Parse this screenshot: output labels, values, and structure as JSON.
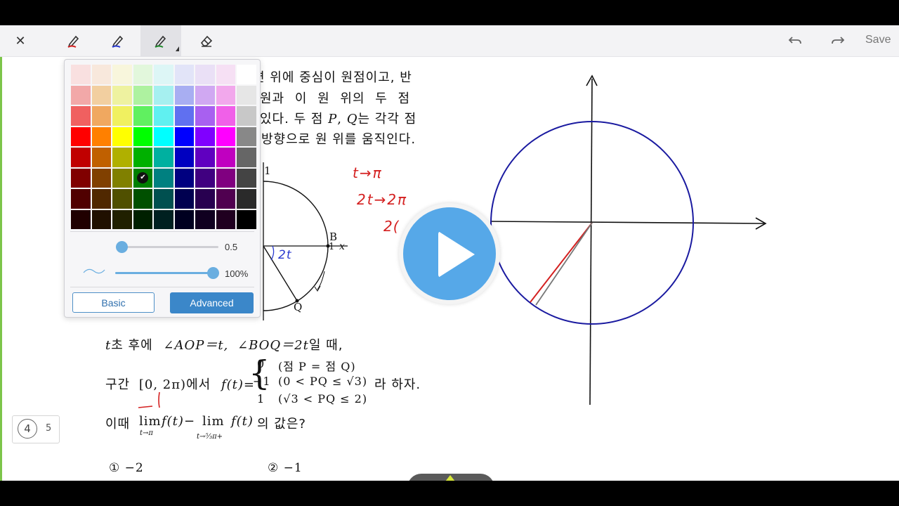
{
  "toolbar": {
    "save_label": "Save",
    "tools": [
      "close",
      "pen-red",
      "pen-blue",
      "pen-green",
      "eraser",
      "undo",
      "redo"
    ],
    "pen_colors": {
      "red": "#d42020",
      "blue": "#2a3ad0",
      "green": "#1f8a2c"
    }
  },
  "problem": {
    "line1": "면 위에 중심이 원점이고, 반",
    "line2": "원과 이 원 위의 두 점",
    "line3": "있다. 두 점",
    "line3_p": "P",
    "line3_sep": ",",
    "line3_q": "Q",
    "line3_rest": "는 각각 점",
    "line4": "방향으로 원 위를 움직인다.",
    "cond_t": "t",
    "cond_text1": "초 후에",
    "cond_angle1": "∠AOP＝t,",
    "cond_angle2": "∠BOQ＝2t",
    "cond_text2": "일 때,",
    "interval_label": "구간",
    "interval": "[0, 2π)",
    "interval_suffix": "에서",
    "f_def": "f(t)=",
    "case1_val": "0",
    "case1_cond": "(점 P = 점 Q)",
    "case2_val": "−1",
    "case2_cond": "(0 < PQ ≤ √3)",
    "case3_val": "1",
    "case3_cond": "(√3 < PQ ≤ 2)",
    "case_suffix": "라 하자.",
    "q_prefix": "이때",
    "lim1": "lim",
    "lim1_sub": "t→π",
    "lim1_f": "f(t)−",
    "lim2": "lim",
    "lim2_sub": "t→⁵⁄₃π+",
    "lim2_f": "f(t)",
    "q_suffix": "의 값은?",
    "choice1": "① −2",
    "choice2": "② −1"
  },
  "figure": {
    "label_1_top": "1",
    "label_B": "B",
    "label_1_right": "1",
    "label_x": "x",
    "label_Q": "Q",
    "label_2t": "2t"
  },
  "handwriting": {
    "line1": "t→π",
    "line2": "2t→2π",
    "line3": "2(",
    "color_red": "#d42020",
    "color_blue": "#2a3ad0"
  },
  "picker": {
    "size_value": 0.5,
    "size_label": "0.5",
    "opacity_value": 100,
    "opacity_label": "100%",
    "basic_label": "Basic",
    "advanced_label": "Advanced",
    "selected_color": "#008000",
    "swatches": [
      [
        "#f9e0e0",
        "#f8e8dc",
        "#f8f6dc",
        "#e2f7dc",
        "#ddf6f6",
        "#e2e4f8",
        "#eae0f6",
        "#f6e0f4",
        "#ffffff"
      ],
      [
        "#f2a8a8",
        "#f2cfa0",
        "#eef2a0",
        "#aef2a0",
        "#a6f0f0",
        "#a8aef2",
        "#d0a8f2",
        "#f2a8ec",
        "#e6e6e6"
      ],
      [
        "#f06060",
        "#f0a860",
        "#f0f060",
        "#60f060",
        "#60f0f0",
        "#6070f0",
        "#a860f0",
        "#f060e8",
        "#c8c8c8"
      ],
      [
        "#ff0000",
        "#ff8000",
        "#ffff00",
        "#00ff00",
        "#00ffff",
        "#0000ff",
        "#8000ff",
        "#ff00ff",
        "#888888"
      ],
      [
        "#c00000",
        "#c06000",
        "#b0b000",
        "#00b000",
        "#00b0a0",
        "#0000c0",
        "#6000c0",
        "#c000c0",
        "#666666"
      ],
      [
        "#800000",
        "#804000",
        "#808000",
        "#008000",
        "#008080",
        "#000080",
        "#400080",
        "#800080",
        "#444444"
      ],
      [
        "#500000",
        "#502800",
        "#505000",
        "#005000",
        "#005050",
        "#000050",
        "#280050",
        "#500050",
        "#2a2a2a"
      ],
      [
        "#200000",
        "#201000",
        "#202000",
        "#002000",
        "#002020",
        "#000020",
        "#100020",
        "#200020",
        "#000000"
      ]
    ]
  },
  "page_indicator": {
    "current": "4",
    "total": "5"
  },
  "graph": {
    "circle_color": "#1a1aa0",
    "red_line": "#d42020",
    "gray_line": "#777777"
  }
}
